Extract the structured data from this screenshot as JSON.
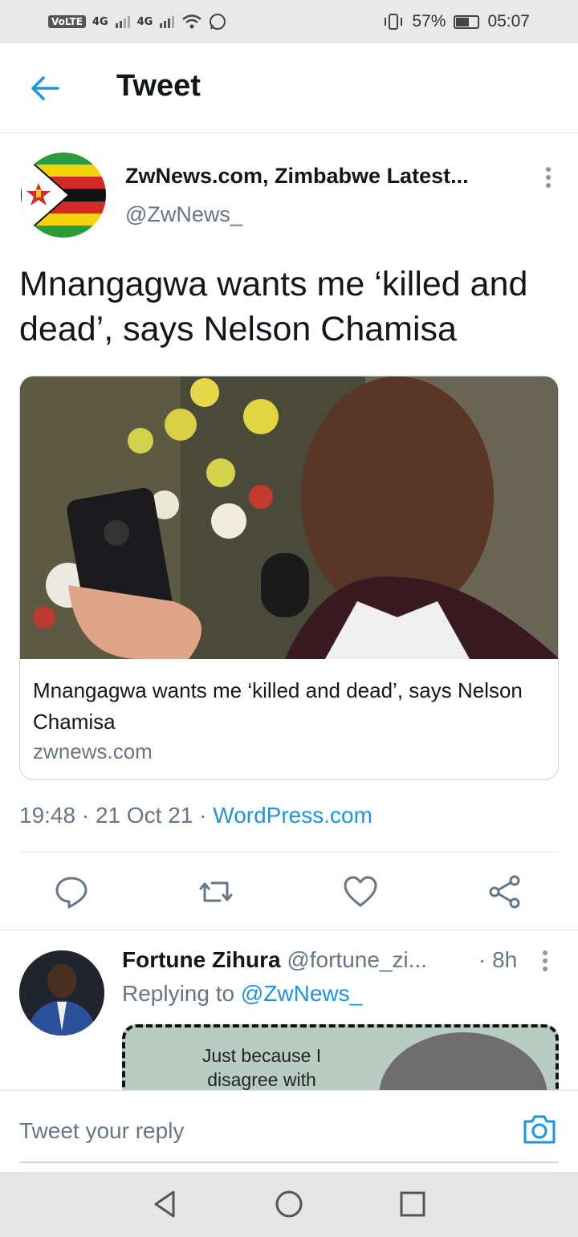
{
  "status_bar": {
    "network_left": "VoLTE",
    "sim1": "4G",
    "sim2": "4G",
    "battery": "57%",
    "time": "05:07"
  },
  "header": {
    "title": "Tweet"
  },
  "tweet": {
    "display_name": "ZwNews.com, Zimbabwe Latest...",
    "handle": "@ZwNews_",
    "text": "Mnangagwa wants me ‘killed and dead’, says Nelson Chamisa",
    "card": {
      "title": "Mnangagwa wants me ‘killed and dead’, says Nelson Chamisa",
      "domain": "zwnews.com"
    },
    "time": "19:48",
    "date": "21 Oct 21",
    "source": "WordPress.com"
  },
  "reply": {
    "name": "Fortune Zihura",
    "handle": "@fortune_zi...",
    "time": "8h",
    "replying_prefix": "Replying to",
    "replying_to": "@ZwNews_",
    "media_text_line1": "Just because I",
    "media_text_line2": "disagree with"
  },
  "composer": {
    "placeholder": "Tweet your reply"
  },
  "colors": {
    "accent": "#1b95e0",
    "secondary_text": "#657786"
  }
}
